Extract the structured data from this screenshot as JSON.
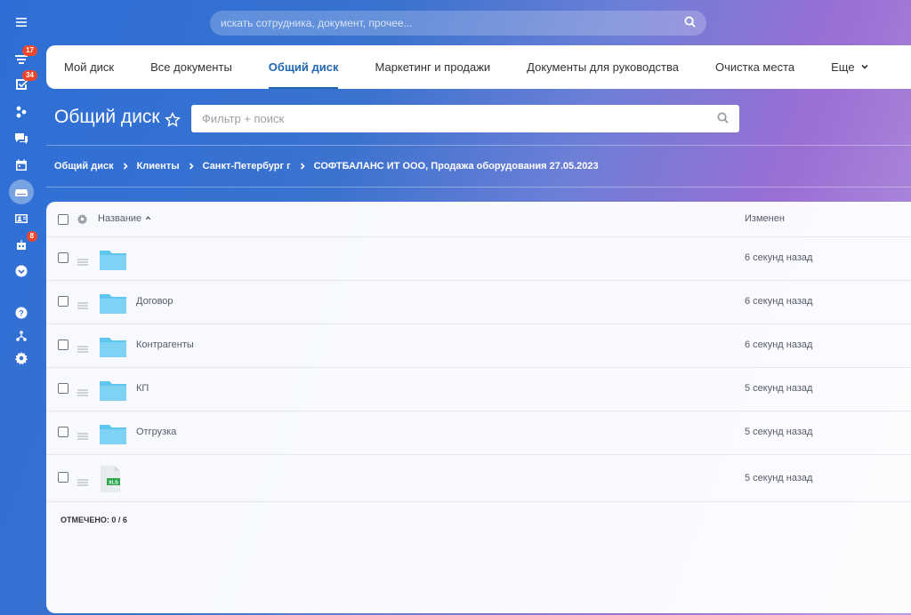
{
  "search": {
    "placeholder": "искать сотрудника, документ, прочее..."
  },
  "rail": {
    "items": [
      {
        "icon": "menu-icon"
      },
      {
        "icon": "feed-icon",
        "badge": "17"
      },
      {
        "icon": "tasks-icon",
        "badge": "34"
      },
      {
        "icon": "crm-icon"
      },
      {
        "icon": "chat-icon"
      },
      {
        "icon": "calendar-icon"
      },
      {
        "icon": "drive-icon"
      },
      {
        "icon": "contacts-icon"
      },
      {
        "icon": "robot-icon",
        "badge": "8"
      },
      {
        "icon": "more-icon"
      },
      {
        "icon": "help-icon"
      },
      {
        "icon": "structure-icon"
      },
      {
        "icon": "settings-icon"
      }
    ]
  },
  "tabs": [
    {
      "label": "Мой диск"
    },
    {
      "label": "Все документы"
    },
    {
      "label": "Общий диск",
      "active": true
    },
    {
      "label": "Маркетинг и продажи"
    },
    {
      "label": "Документы для руководства"
    },
    {
      "label": "Очистка места"
    }
  ],
  "tabs_more": "Еще",
  "page": {
    "title": "Общий диск",
    "filter_placeholder": "Фильтр + поиск"
  },
  "breadcrumb": [
    "Общий диск",
    "Клиенты",
    "Санкт-Петербург г",
    "СОФТБАЛАНС ИТ ООО, Продажа оборудования 27.05.2023"
  ],
  "table": {
    "col_name": "Название",
    "col_modified": "Изменен",
    "rows": [
      {
        "type": "folder",
        "name": "",
        "modified": "6 секунд назад"
      },
      {
        "type": "folder",
        "name": "Договор",
        "modified": "6 секунд назад"
      },
      {
        "type": "folder",
        "name": "Контрагенты",
        "modified": "6 секунд назад"
      },
      {
        "type": "folder",
        "name": "КП",
        "modified": "5 секунд назад"
      },
      {
        "type": "folder",
        "name": "Отгрузка",
        "modified": "5 секунд назад"
      },
      {
        "type": "file",
        "file_label": "XLS",
        "name": "",
        "modified": "5 секунд назад"
      }
    ],
    "selected_label": "ОТМЕЧЕНО: 0 / 6"
  },
  "colors": {
    "accent": "#2067b0",
    "folder": "#5fc6ef",
    "badge": "#f0462c"
  }
}
